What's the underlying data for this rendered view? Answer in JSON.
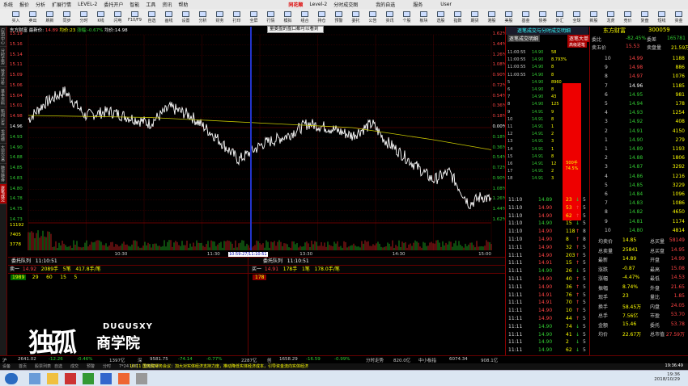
{
  "menubar": {
    "items": [
      "系统",
      "报价",
      "分析",
      "扩展行情",
      "LEVEL-2",
      "委托开户",
      "智能",
      "工具",
      "资讯",
      "帮助"
    ],
    "brand": "同花顺",
    "level": "Level-2",
    "center_text": "分时成交图",
    "right_items": [
      "我的自选",
      "服务",
      "User"
    ]
  },
  "toolbar": {
    "buttons": [
      "买入",
      "卖出",
      "刷新",
      "同步",
      "分时",
      "K线",
      "闪电",
      "F10/F9",
      "自选",
      "画线",
      "设置",
      "分析",
      "财务",
      "打印",
      "全屏",
      "行情",
      "模拟",
      "组合",
      "持仓",
      "预警",
      "委托",
      "公告",
      "资讯",
      "个股",
      "板块",
      "选股",
      "指数",
      "期货",
      "港股",
      "美股",
      "基金",
      "债券",
      "外汇",
      "全球",
      "新股",
      "龙虎",
      "竞价",
      "复盘",
      "短线",
      "资金"
    ]
  },
  "sidetabs": [
    "应用中心",
    "分时走势",
    "技术分析",
    "基本资料",
    "新闻公告",
    "龙虎榜",
    "大宗交易",
    "融资融券",
    "逐笔成交"
  ],
  "chart_header": {
    "name": "东方财富",
    "price_label": "最新价:",
    "price": "14.89",
    "vol": "均价:23",
    "change": "涨幅:-0.67%",
    "avg": "均价:14.98"
  },
  "popup": "量委盘的盘口都可以看到",
  "cursor_time": "10:59:27/11:10:51",
  "price_labels_left": [
    "15.19",
    "15.16",
    "15.14",
    "15.11",
    "15.09",
    "15.06",
    "15.04",
    "15.01",
    "14.98",
    "14.96",
    "14.93",
    "14.90",
    "14.88",
    "14.85",
    "14.83",
    "14.80",
    "14.78",
    "14.75",
    "14.73"
  ],
  "pct_labels_right": [
    "1.62%",
    "1.44%",
    "1.26%",
    "1.08%",
    "0.90%",
    "0.72%",
    "0.54%",
    "0.36%",
    "0.18%",
    "0.00%",
    "0.18%",
    "0.36%",
    "0.54%",
    "0.72%",
    "0.90%",
    "1.08%",
    "1.26%",
    "1.44%",
    "1.62%"
  ],
  "vol_labels": [
    "11192",
    "7405",
    "3778"
  ],
  "time_labels": [
    "10:30",
    "11:30",
    "13:30",
    "14:30",
    "15:00"
  ],
  "orderbook": {
    "sell_header": [
      "卖一",
      "14.92",
      "2089手",
      "5笔",
      "417.8手/笔"
    ],
    "sell_vals": [
      "1989",
      "29",
      "60",
      "15",
      "5"
    ],
    "sell_title": "委托队列",
    "sell_time": "11:10:51",
    "buy_header": [
      "买一",
      "14.91",
      "178手",
      "1笔",
      "178.0手/笔"
    ],
    "buy_val": "178",
    "buy_title": "委托队列",
    "buy_time": "11:10:51"
  },
  "mid_panel": {
    "title": "逐笔成交与分时成交明细",
    "tab_active": "逐笔成交明细",
    "tab_right": "逐笔大单",
    "sub_tab": "高级逐笔",
    "top_rows": [
      [
        "11:00:55",
        "14.90",
        "58"
      ],
      [
        "11:00:55",
        "14.90",
        "8.793%"
      ],
      [
        "11:00:55",
        "14.90",
        "8"
      ],
      [
        "11:00:55",
        "14.90",
        "8"
      ],
      [
        "5",
        "14.90",
        "8960"
      ],
      [
        "6",
        "14.90",
        "8"
      ],
      [
        "7",
        "14.90",
        "43"
      ],
      [
        "8",
        "14.90",
        "125"
      ],
      [
        "9",
        "14.91",
        "9"
      ],
      [
        "10",
        "14.91",
        "8"
      ],
      [
        "11",
        "14.91",
        "1"
      ],
      [
        "12",
        "14.91",
        "2"
      ],
      [
        "13",
        "14.91",
        "3"
      ],
      [
        "14",
        "14.91",
        "1"
      ],
      [
        "15",
        "14.91",
        "8"
      ],
      [
        "16",
        "14.91",
        "12"
      ],
      [
        "17",
        "14.91",
        "2"
      ],
      [
        "18",
        "14.91",
        "3"
      ]
    ],
    "red_box_value": "500手",
    "red_box_pct": "74.5%",
    "trades": [
      [
        "11:10",
        "14.89",
        "23",
        "↓",
        "5"
      ],
      [
        "11:10",
        "14.90",
        "53",
        "↑",
        "5"
      ],
      [
        "11:10",
        "14.90",
        "62",
        "↑",
        "5"
      ],
      [
        "11:10",
        "14.90",
        "15",
        "↓",
        "5"
      ],
      [
        "11:10",
        "14.90",
        "118",
        "↑",
        "8"
      ],
      [
        "11:10",
        "14.90",
        "8",
        "↑",
        "8"
      ],
      [
        "11:11",
        "14.90",
        "32",
        "↑",
        "5"
      ],
      [
        "11:11",
        "14.90",
        "203",
        "↑",
        "5"
      ],
      [
        "11:11",
        "14.91",
        "15",
        "↑",
        "5"
      ],
      [
        "11:11",
        "14.90",
        "26",
        "↓",
        "5"
      ],
      [
        "11:11",
        "14.90",
        "40",
        "↑",
        "5"
      ],
      [
        "11:11",
        "14.90",
        "36",
        "↑",
        "5"
      ],
      [
        "11:11",
        "14.91",
        "76",
        "↑",
        "5"
      ],
      [
        "11:11",
        "14.91",
        "70",
        "↑",
        "5"
      ],
      [
        "11:11",
        "14.90",
        "10",
        "↑",
        "5"
      ],
      [
        "11:11",
        "14.90",
        "44",
        "↑",
        "5"
      ],
      [
        "11:11",
        "14.90",
        "74",
        "↓",
        "5"
      ],
      [
        "11:11",
        "14.90",
        "41",
        "↓",
        "5"
      ],
      [
        "11:11",
        "14.90",
        "2",
        "↓",
        "5"
      ],
      [
        "11:11",
        "14.90",
        "62",
        "↓",
        "5"
      ]
    ]
  },
  "right_panel": {
    "name": "东方财富",
    "code": "300059",
    "weibi_label": "委比",
    "weibi": "-82.45%",
    "weicha_label": "委差",
    "weicha": "165781",
    "asks_label": "卖五价",
    "ask_top": [
      "15.53",
      "21.59万"
    ],
    "ask_top_label": "卖盘量",
    "ladder": [
      [
        "10",
        "14.99",
        "1188"
      ],
      [
        "9",
        "14.98",
        "886"
      ],
      [
        "8",
        "14.97",
        "1076"
      ],
      [
        "7",
        "14.96",
        "1185"
      ],
      [
        "6",
        "14.95",
        "981"
      ],
      [
        "5",
        "14.94",
        "178"
      ],
      [
        "4",
        "14.93",
        "1254"
      ],
      [
        "3",
        "14.92",
        "408"
      ],
      [
        "2",
        "14.91",
        "4150"
      ],
      [
        "1",
        "14.90",
        "279"
      ],
      [
        "1",
        "14.89",
        "1193"
      ],
      [
        "2",
        "14.88",
        "1806"
      ],
      [
        "3",
        "14.87",
        "3292"
      ],
      [
        "4",
        "14.86",
        "1216"
      ],
      [
        "5",
        "14.85",
        "3229"
      ],
      [
        "6",
        "14.84",
        "1096"
      ],
      [
        "7",
        "14.83",
        "1086"
      ],
      [
        "8",
        "14.82",
        "4650"
      ],
      [
        "9",
        "14.81",
        "1174"
      ],
      [
        "10",
        "14.80",
        "4814"
      ]
    ],
    "stats": [
      [
        "均卖价",
        "14.85",
        "总买量",
        "58149"
      ],
      [
        "总卖量",
        "25841",
        "总买盘",
        "14.95"
      ],
      [
        "最新",
        "14.89",
        "开盘",
        "14.99"
      ],
      [
        "涨跌",
        "-0.87",
        "最高",
        "15.08"
      ],
      [
        "涨幅",
        "-4.47%",
        "最低",
        "14.53"
      ],
      [
        "振幅",
        "8.74%",
        "外盘",
        "21.65"
      ],
      [
        "现手",
        "23",
        "量比",
        "1.85"
      ],
      [
        "换手",
        "58.45万",
        "内盘",
        "24.05"
      ],
      [
        "总手",
        "7.56亿",
        "市盈",
        "53.70"
      ],
      [
        "金额",
        "15.46",
        "委托",
        "53.78"
      ],
      [
        "均价",
        "22.67万",
        "总市值",
        "27.59万"
      ]
    ]
  },
  "bottom_bar": [
    "沪",
    "2641.02",
    "-12.26",
    "-0.46%",
    "1397亿",
    "深",
    "9581.75",
    "-74.14",
    "-0.77%",
    "2287亿",
    "创",
    "1658.29",
    "-16.59",
    "-0.99%",
    "分时走势",
    "820.0亿",
    "中小板指",
    "6074.34",
    "908.1亿"
  ],
  "status": {
    "items": [
      "设备",
      "首页",
      "股票列表",
      "自选",
      "成交",
      "预警",
      "分时",
      "7*24 小时",
      "智能助手"
    ],
    "ticker": "10:11 国务院常务会议：加大对实体经济支持力度，推动降低实体经济成本，引导资金流向实体经济",
    "time": "19:36:49"
  },
  "taskbar": {
    "clock": "19:36",
    "date": "2018/10/29"
  },
  "watermark": {
    "big": "独孤",
    "en": "DUGUSXY",
    "cn": "商学院"
  },
  "colors": {
    "up": "#ff4444",
    "down": "#33cc33",
    "price": "#ffffff",
    "avg": "#c8c800",
    "grid": "#550000",
    "cursor": "#2233cc"
  }
}
